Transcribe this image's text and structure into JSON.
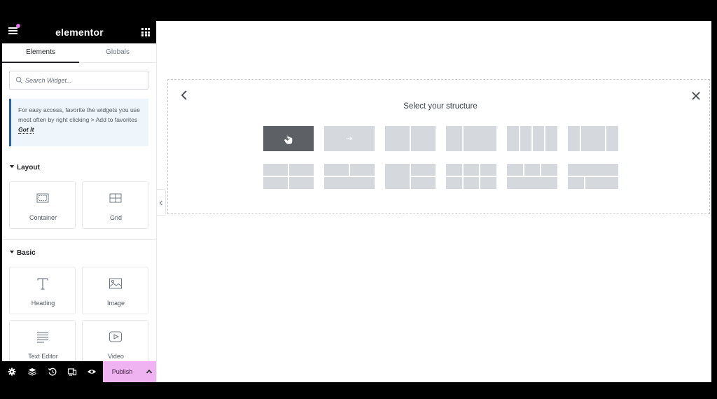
{
  "app": {
    "logo": "elementor"
  },
  "tabs": [
    {
      "label": "Elements",
      "active": true
    },
    {
      "label": "Globals",
      "active": false
    }
  ],
  "search": {
    "placeholder": "Search Widget..."
  },
  "notice": {
    "text": "For easy access, favorite the widgets you use most often by right clicking > Add to favorites",
    "link": "Got It"
  },
  "categories": {
    "layout": {
      "title": "Layout",
      "widgets": [
        {
          "label": "Container",
          "icon": "container-icon"
        },
        {
          "label": "Grid",
          "icon": "grid-icon"
        }
      ]
    },
    "basic": {
      "title": "Basic",
      "widgets": [
        {
          "label": "Heading",
          "icon": "heading-icon"
        },
        {
          "label": "Image",
          "icon": "image-icon"
        },
        {
          "label": "Text Editor",
          "icon": "text-editor-icon"
        },
        {
          "label": "Video",
          "icon": "video-icon"
        }
      ]
    }
  },
  "footer": {
    "icons": [
      "settings-icon",
      "layers-icon",
      "history-icon",
      "responsive-icon",
      "preview-icon"
    ],
    "publish_label": "Publish"
  },
  "canvas": {
    "structure_title": "Select your structure",
    "selected_preset": 0,
    "preset_count": 12
  },
  "colors": {
    "accent": "#f0b3f2",
    "header": "#000000",
    "selected_preset": "#5d6166",
    "preset": "#d5d8dc",
    "notice_border": "#2563a8"
  }
}
